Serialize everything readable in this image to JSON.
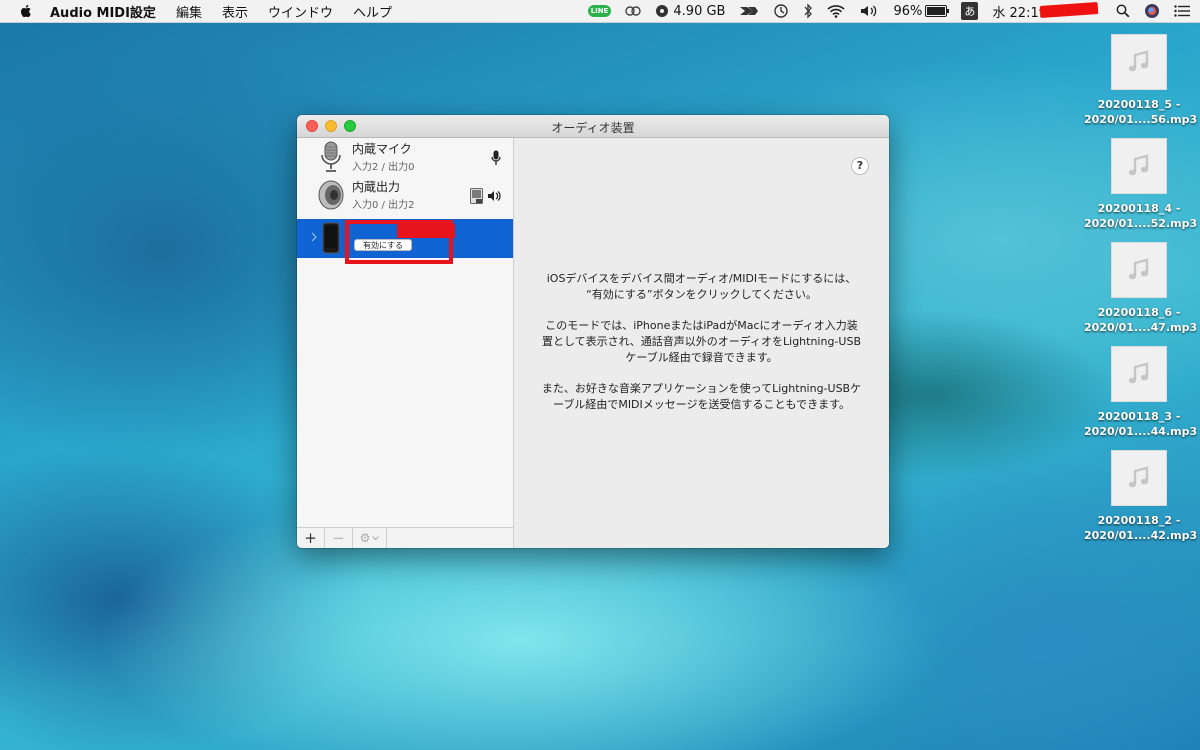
{
  "menubar": {
    "app_name": "Audio MIDI設定",
    "menus": [
      "編集",
      "表示",
      "ウインドウ",
      "ヘルプ"
    ],
    "status": {
      "line_label": "LINE",
      "storage": "4.90 GB",
      "battery": "96%",
      "battery_level": 0.96,
      "input_method": "あ",
      "clock": "水 22:19"
    }
  },
  "desktop_files": [
    {
      "line1": "20200118_5 -",
      "line2": "2020/01....56.mp3"
    },
    {
      "line1": "20200118_4 -",
      "line2": "2020/01....52.mp3"
    },
    {
      "line1": "20200118_6 -",
      "line2": "2020/01....47.mp3"
    },
    {
      "line1": "20200118_3 -",
      "line2": "2020/01....44.mp3"
    },
    {
      "line1": "20200118_2 -",
      "line2": "2020/01....42.mp3"
    }
  ],
  "window": {
    "title": "オーディオ装置",
    "devices": [
      {
        "name": "内蔵マイク",
        "io": "入力2 / 出力0"
      },
      {
        "name": "内蔵出力",
        "io": "入力0 / 出力2"
      },
      {
        "enable_label": "有効にする"
      }
    ],
    "toolbar": {
      "add": "+",
      "remove": "−",
      "gear": "⚙"
    },
    "help": "?",
    "message": {
      "p1": [
        "iOSデバイスをデバイス間オーディオ/MIDIモードにするには、",
        "“有効にする”ボタンをクリックしてください。"
      ],
      "p2": [
        "このモードでは、iPhoneまたはiPadがMacにオーディオ入力装",
        "置として表示され、通話音声以外のオーディオをLightning-USB",
        "ケーブル経由で録音できます。"
      ],
      "p3": [
        "また、お好きな音楽アプリケーションを使ってLightning-USBケ",
        "ーブル経由でMIDIメッセージを送受信することもできます。"
      ]
    }
  },
  "colors": {
    "selection": "#0f63d3",
    "redaction": "#e8141c"
  }
}
